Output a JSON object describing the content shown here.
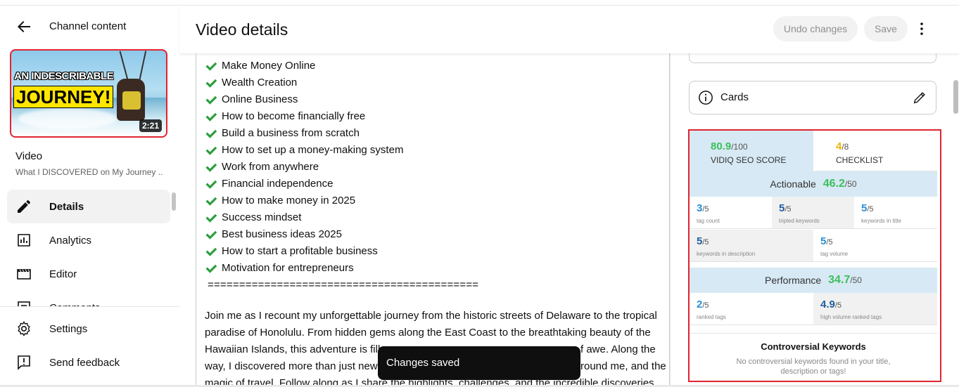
{
  "sidebar": {
    "title": "Channel content",
    "thumbnail": {
      "line1": "AN INDESCRIBABLE",
      "line2": "JOURNEY!",
      "duration": "2:21"
    },
    "video_label": "Video",
    "video_title": "What I DISCOVERED on My Journey ...",
    "nav": [
      {
        "label": "Details",
        "icon": "pencil-icon",
        "active": true
      },
      {
        "label": "Analytics",
        "icon": "analytics-icon"
      },
      {
        "label": "Editor",
        "icon": "clapperboard-icon"
      },
      {
        "label": "Comments",
        "icon": "comments-icon"
      }
    ],
    "bottom_nav": [
      {
        "label": "Settings",
        "icon": "gear-icon"
      },
      {
        "label": "Send feedback",
        "icon": "feedback-icon"
      }
    ]
  },
  "header": {
    "title": "Video details",
    "undo_label": "Undo changes",
    "save_label": "Save"
  },
  "description": {
    "checklist": [
      "Make Money Online",
      "Wealth Creation",
      "Online Business",
      "How to become financially free",
      "Build a business from scratch",
      "How to set up a money-making system",
      "Work from anywhere",
      "Financial independence",
      "How to make money in 2025",
      "Success mindset",
      "Best business ideas 2025",
      "How to start a profitable business",
      "Motivation for entrepreneurs"
    ],
    "separator": "===========================================",
    "paragraph_lines": [
      "Join me as I recount my unforgettable journey from the historic streets of Delaware to the tropical",
      "paradise of Honolulu. From hidden gems along the East Coast to the breathtaking beauty of the",
      "Hawaiian Islands, this adventure is fill",
      "way, I discovered more than just new",
      "magic of travel. Follow along as I share the highlights, challenges, and the incredible discoveries"
    ],
    "paragraph_tails": [
      "f awe. Along the",
      "round me, and the"
    ]
  },
  "right_panel": {
    "cards_label": "Cards",
    "vidiq": {
      "seo_score": "80.9",
      "seo_den": "/100",
      "seo_caption": "VIDIQ SEO SCORE",
      "checklist_score": "4",
      "checklist_den": "/8",
      "checklist_caption": "CHECKLIST",
      "actionable_label": "Actionable",
      "actionable_value": "46.2",
      "actionable_den": "/50",
      "actionable_metrics": [
        {
          "value": "3",
          "den": "/5",
          "caption": "tag count"
        },
        {
          "value": "5",
          "den": "/5",
          "caption": "tripled keywords"
        },
        {
          "value": "5",
          "den": "/5",
          "caption": "keywords in title"
        },
        {
          "value": "5",
          "den": "/5",
          "caption": "keywords in description"
        },
        {
          "value": "5",
          "den": "/5",
          "caption": "tag volume"
        }
      ],
      "performance_label": "Performance",
      "performance_value": "34.7",
      "performance_den": "/50",
      "performance_metrics": [
        {
          "value": "2",
          "den": "/5",
          "caption": "ranked tags"
        },
        {
          "value": "4.9",
          "den": "/5",
          "caption": "high volume ranked tags"
        }
      ],
      "controversial_title": "Controversial Keywords",
      "controversial_text": "No controversial keywords found in your title, description or tags!"
    }
  },
  "toast": {
    "text": "Changes saved"
  },
  "colors": {
    "accent_red": "#e0242f",
    "score_green": "#3cbf5c",
    "score_yellow": "#f0b400",
    "metric_blue": "#2a8fd4",
    "check_green": "#2c9e3c"
  }
}
